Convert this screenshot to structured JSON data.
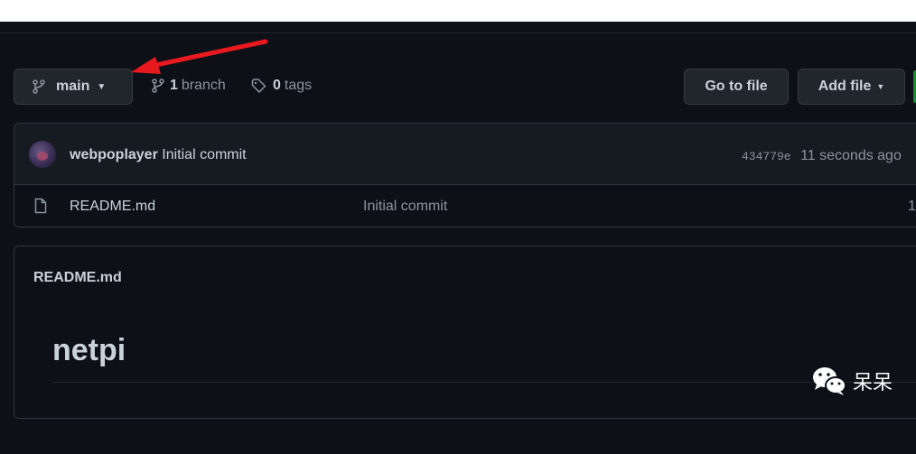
{
  "repo_bar": {
    "branch_button_label": "main",
    "branch_count": "1",
    "branch_label": "branch",
    "tag_count": "0",
    "tag_label": "tags",
    "go_to_file_label": "Go to file",
    "add_file_label": "Add file"
  },
  "latest_commit": {
    "author": "webpoplayer",
    "message": "Initial commit",
    "sha": "434779e",
    "age": "11 seconds ago"
  },
  "files": [
    {
      "name": "README.md",
      "commit_message": "Initial commit",
      "age": "1"
    }
  ],
  "readme": {
    "title": "README.md",
    "heading": "netpi"
  },
  "watermark": {
    "text": "呆呆"
  },
  "colors": {
    "background": "#0d1117",
    "annotation_arrow": "#e8191f",
    "primary_button": "#238636"
  },
  "icons": [
    "git-branch-icon",
    "tag-icon",
    "file-icon",
    "caret-down-icon",
    "wechat-icon",
    "avatar"
  ]
}
